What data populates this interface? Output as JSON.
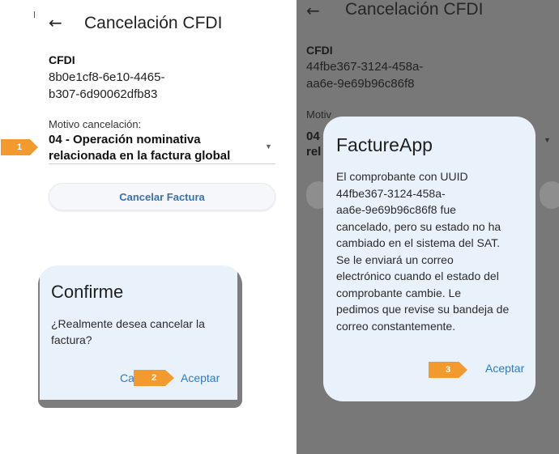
{
  "left_screen": {
    "header": {
      "back_icon": "arrow-left",
      "title": "Cancelación CFDI"
    },
    "cfdi": {
      "label": "CFDI",
      "uuid_line1": "8b0e1cf8-6e10-4465-",
      "uuid_line2": "b307-6d90062dfb83"
    },
    "motivo": {
      "label": "Motivo cancelación:",
      "selected_line1": "04 - Operación nominativa",
      "selected_line2": "relacionada en la factura global"
    },
    "cancel_button_label": "Cancelar Factura",
    "confirm_dialog": {
      "title": "Confirme",
      "body_line1": "¿Realmente desea cancelar la",
      "body_line2": "factura?",
      "cancel_label": "Ca",
      "accept_label": "Aceptar"
    }
  },
  "right_screen": {
    "header": {
      "back_icon": "arrow-left",
      "title": "Cancelación CFDI"
    },
    "cfdi": {
      "label": "CFDI",
      "uuid_line1": "44fbe367-3124-458a-",
      "uuid_line2": "aa6e-9e69b96c86f8"
    },
    "motivo_partial": "Motiv",
    "select_partial": "04",
    "select_partial2": "rel",
    "dialog": {
      "title": "FactureApp",
      "lines": [
        "El comprobante con UUID",
        "44fbe367-3124-458a-",
        "aa6e-9e69b96c86f8 fue",
        "cancelado, pero su estado no ha",
        "cambiado en el sistema del SAT.",
        "Se le enviará un correo",
        "electrónico cuando el estado del",
        "comprobante cambie. Le",
        "pedimos que revise su bandeja de",
        "correo constantemente."
      ],
      "accept_label": "Aceptar"
    }
  },
  "markers": {
    "m1": "1",
    "m2": "2",
    "m3": "3"
  },
  "colors": {
    "marker": "#f39a2e",
    "accent": "#2f7bc4",
    "dialog_bg": "#e9f2fb",
    "scrim": "#787878"
  }
}
